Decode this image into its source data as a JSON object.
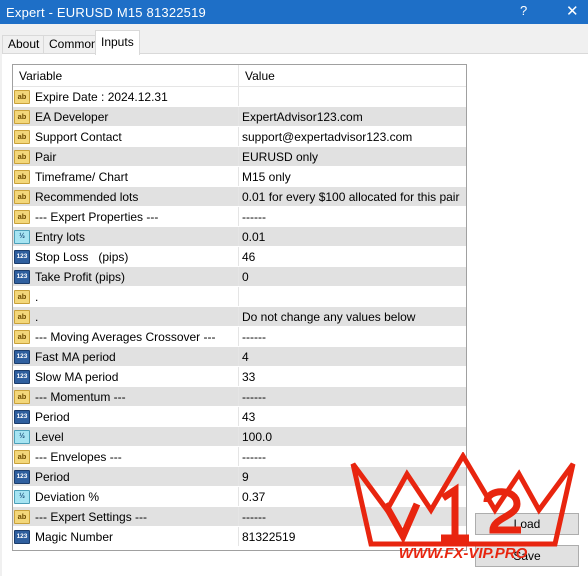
{
  "window": {
    "title": "Expert - EURUSD M15 81322519",
    "help": "?",
    "close": "✕"
  },
  "tabs": [
    {
      "label": "About"
    },
    {
      "label": "Common"
    },
    {
      "label": "Inputs"
    }
  ],
  "table": {
    "headers": {
      "variable": "Variable",
      "value": "Value"
    },
    "rows": [
      {
        "icon": "ab",
        "name": "Expire Date : 2024.12.31",
        "value": ""
      },
      {
        "icon": "ab",
        "name": "EA Developer",
        "value": "ExpertAdvisor123.com"
      },
      {
        "icon": "ab",
        "name": "Support Contact",
        "value": "support@expertadvisor123.com"
      },
      {
        "icon": "ab",
        "name": "Pair",
        "value": "EURUSD only"
      },
      {
        "icon": "ab",
        "name": "Timeframe/ Chart",
        "value": "M15 only"
      },
      {
        "icon": "ab",
        "name": "Recommended lots",
        "value": "0.01 for every $100 allocated for this pair"
      },
      {
        "icon": "ab",
        "name": "--- Expert Properties ---",
        "value": "------"
      },
      {
        "icon": "dbl",
        "name": "Entry lots",
        "value": "0.01"
      },
      {
        "icon": "num",
        "name": "Stop Loss   (pips)",
        "value": "46"
      },
      {
        "icon": "num",
        "name": "Take Profit (pips)",
        "value": "0"
      },
      {
        "icon": "ab",
        "name": ".",
        "value": ""
      },
      {
        "icon": "ab",
        "name": ".",
        "value": "Do not change any values below"
      },
      {
        "icon": "ab",
        "name": "--- Moving Averages Crossover ---",
        "value": "------"
      },
      {
        "icon": "num",
        "name": "Fast MA period",
        "value": "4"
      },
      {
        "icon": "num",
        "name": "Slow MA period",
        "value": "33"
      },
      {
        "icon": "ab",
        "name": "--- Momentum ---",
        "value": "------"
      },
      {
        "icon": "num",
        "name": "Period",
        "value": "43"
      },
      {
        "icon": "dbl",
        "name": "Level",
        "value": "100.0"
      },
      {
        "icon": "ab",
        "name": "--- Envelopes ---",
        "value": "------"
      },
      {
        "icon": "num",
        "name": "Period",
        "value": "9"
      },
      {
        "icon": "dbl",
        "name": "Deviation %",
        "value": "0.37"
      },
      {
        "icon": "ab",
        "name": "--- Expert Settings ---",
        "value": "------"
      },
      {
        "icon": "num",
        "name": "Magic Number",
        "value": "81322519"
      }
    ]
  },
  "icon_glyphs": {
    "ab": "ab",
    "num": "123",
    "dbl": "½"
  },
  "buttons": {
    "load": "Load",
    "save": "Save"
  },
  "watermark": {
    "text": "WWW.FX-VIP.PRO",
    "color": "#e8250f"
  }
}
